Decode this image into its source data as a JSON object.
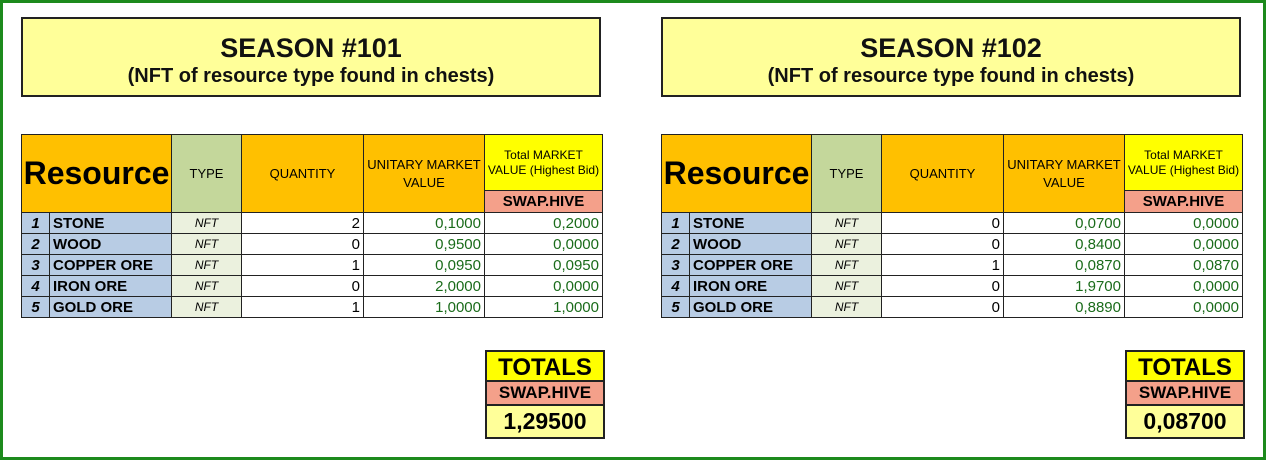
{
  "seasons": [
    {
      "title": "SEASON #101",
      "subtitle": "(NFT of resource type found in chests)",
      "headers": {
        "resource": "Resource",
        "type": "TYPE",
        "quantity": "QUANTITY",
        "unitary": "UNITARY MARKET VALUE",
        "total": "Total MARKET VALUE (Highest Bid)",
        "swap": "SWAP.HIVE"
      },
      "rows": [
        {
          "idx": "1",
          "name": "STONE",
          "type": "NFT",
          "qty": "2",
          "unit": "0,1000",
          "total": "0,2000"
        },
        {
          "idx": "2",
          "name": "WOOD",
          "type": "NFT",
          "qty": "0",
          "unit": "0,9500",
          "total": "0,0000"
        },
        {
          "idx": "3",
          "name": "COPPER ORE",
          "type": "NFT",
          "qty": "1",
          "unit": "0,0950",
          "total": "0,0950"
        },
        {
          "idx": "4",
          "name": "IRON ORE",
          "type": "NFT",
          "qty": "0",
          "unit": "2,0000",
          "total": "0,0000"
        },
        {
          "idx": "5",
          "name": "GOLD ORE",
          "type": "NFT",
          "qty": "1",
          "unit": "1,0000",
          "total": "1,0000"
        }
      ],
      "totals": {
        "label": "TOTALS",
        "currency": "SWAP.HIVE",
        "value": "1,29500"
      }
    },
    {
      "title": "SEASON #102",
      "subtitle": "(NFT of resource type found in chests)",
      "headers": {
        "resource": "Resource",
        "type": "TYPE",
        "quantity": "QUANTITY",
        "unitary": "UNITARY MARKET VALUE",
        "total": "Total MARKET VALUE (Highest Bid)",
        "swap": "SWAP.HIVE"
      },
      "rows": [
        {
          "idx": "1",
          "name": "STONE",
          "type": "NFT",
          "qty": "0",
          "unit": "0,0700",
          "total": "0,0000"
        },
        {
          "idx": "2",
          "name": "WOOD",
          "type": "NFT",
          "qty": "0",
          "unit": "0,8400",
          "total": "0,0000"
        },
        {
          "idx": "3",
          "name": "COPPER ORE",
          "type": "NFT",
          "qty": "1",
          "unit": "0,0870",
          "total": "0,0870"
        },
        {
          "idx": "4",
          "name": "IRON ORE",
          "type": "NFT",
          "qty": "0",
          "unit": "1,9700",
          "total": "0,0000"
        },
        {
          "idx": "5",
          "name": "GOLD ORE",
          "type": "NFT",
          "qty": "0",
          "unit": "0,8890",
          "total": "0,0000"
        }
      ],
      "totals": {
        "label": "TOTALS",
        "currency": "SWAP.HIVE",
        "value": "0,08700"
      }
    }
  ]
}
